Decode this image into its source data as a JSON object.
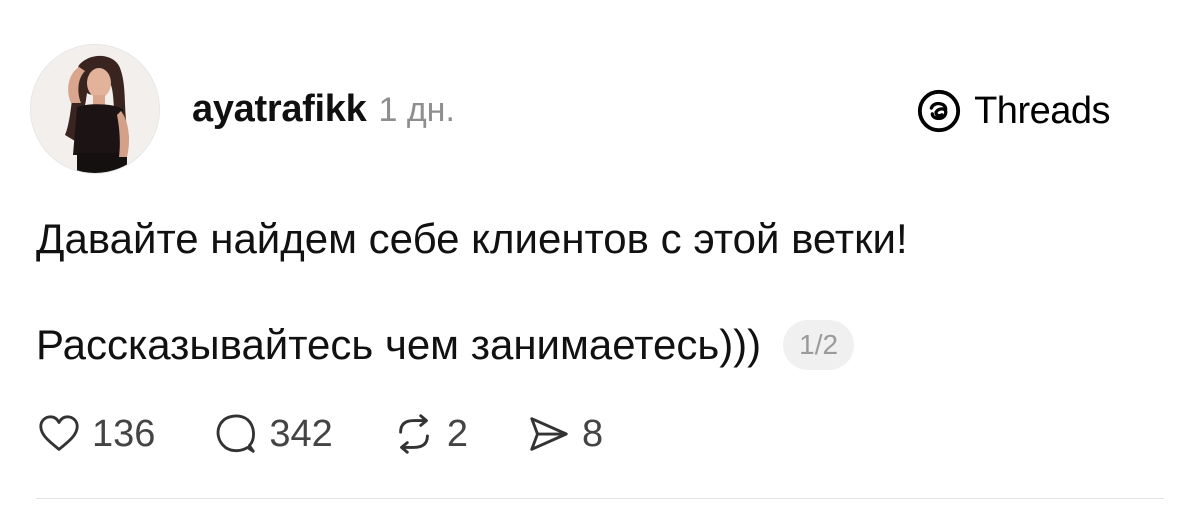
{
  "post": {
    "author": {
      "username": "ayatrafikk",
      "timestamp": "1 дн."
    },
    "brand": {
      "name": "Threads",
      "icon": "threads-logo-icon"
    },
    "text_lines": [
      "Давайте найдем себе клиентов с этой ветки!",
      "Рассказывайтесь чем занимаетесь)))"
    ],
    "page_indicator": "1/2",
    "actions": {
      "likes": {
        "icon": "heart-icon",
        "count": "136"
      },
      "replies": {
        "icon": "comment-icon",
        "count": "342"
      },
      "reposts": {
        "icon": "repost-icon",
        "count": "2"
      },
      "shares": {
        "icon": "send-icon",
        "count": "8"
      }
    }
  },
  "colors": {
    "text": "#111111",
    "muted": "#8e8e8e",
    "badge_bg": "#f0f0f0",
    "divider": "#e4e4e4"
  }
}
